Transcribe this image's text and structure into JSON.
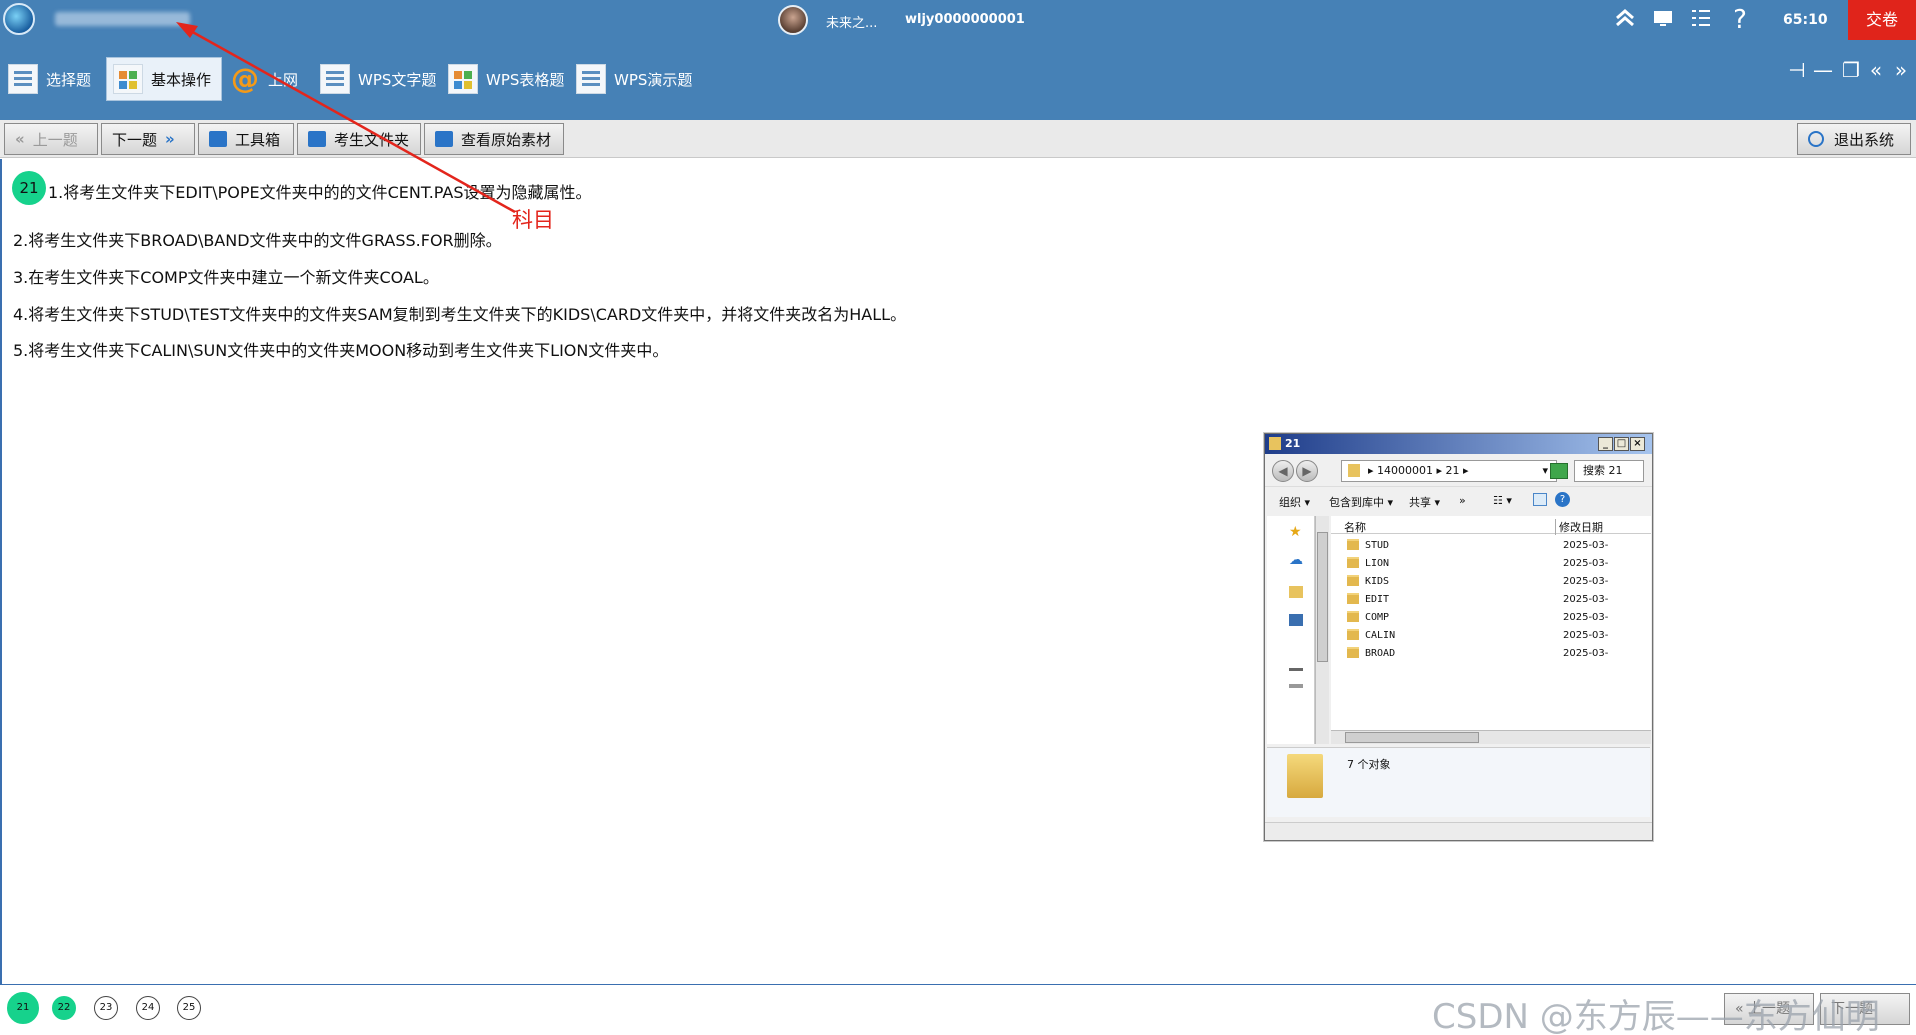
{
  "titlebar": {
    "user_name": "未来之...",
    "user_id": "wljy0000000001",
    "timer": "65:10",
    "submit_label": "交卷",
    "icons": [
      "collapse-icon",
      "monitor-icon",
      "checklist-icon",
      "help-icon"
    ],
    "help_glyph": "?"
  },
  "categories": [
    {
      "label": "选择题",
      "icon": "list-icon",
      "active": false
    },
    {
      "label": "基本操作",
      "icon": "grid-icon",
      "active": true
    },
    {
      "label": "上网",
      "icon": "at-icon",
      "active": false
    },
    {
      "label": "WPS文字题",
      "icon": "document-icon",
      "active": false
    },
    {
      "label": "WPS表格题",
      "icon": "spreadsheet-icon",
      "active": false
    },
    {
      "label": "WPS演示题",
      "icon": "presentation-icon",
      "active": false
    }
  ],
  "toolbar": {
    "prev_label": "上一题",
    "next_label": "下一题",
    "toolbox_label": "工具箱",
    "exam_folder_label": "考生文件夹",
    "view_material_label": "查看原始素材",
    "exit_label": "退出系统"
  },
  "question": {
    "number": "21",
    "lines": [
      "1.将考生文件夹下EDIT\\POPE文件夹中的的文件CENT.PAS设置为隐藏属性。",
      "2.将考生文件夹下BROAD\\BAND文件夹中的文件GRASS.FOR删除。",
      "3.在考生文件夹下COMP文件夹中建立一个新文件夹COAL。",
      "4.将考生文件夹下STUD\\TEST文件夹中的文件夹SAM复制到考生文件夹下的KIDS\\CARD文件夹中，并将文件夹改名为HALL。",
      "5.将考生文件夹下CALIN\\SUN文件夹中的文件夹MOON移动到考生文件夹下LION文件夹中。"
    ]
  },
  "annotation": {
    "label": "科目",
    "color": "#e3251c"
  },
  "explorer": {
    "title": "21",
    "address": "▸ 14000001 ▸ 21 ▸",
    "search_placeholder": "搜索 21",
    "commands": [
      "组织 ▾",
      "包含到库中 ▾",
      "共享 ▾",
      "»"
    ],
    "column_name": "名称",
    "column_date": "修改日期",
    "files": [
      {
        "name": "STUD",
        "date": "2025-03-"
      },
      {
        "name": "LION",
        "date": "2025-03-"
      },
      {
        "name": "KIDS",
        "date": "2025-03-"
      },
      {
        "name": "EDIT",
        "date": "2025-03-"
      },
      {
        "name": "COMP",
        "date": "2025-03-"
      },
      {
        "name": "CALIN",
        "date": "2025-03-"
      },
      {
        "name": "BROAD",
        "date": "2025-03-"
      }
    ],
    "status": "7 个对象"
  },
  "footer": {
    "questions": [
      {
        "number": "21",
        "done": true,
        "current": true
      },
      {
        "number": "22",
        "done": true,
        "current": false
      },
      {
        "number": "23",
        "done": false,
        "current": false
      },
      {
        "number": "24",
        "done": false,
        "current": false
      },
      {
        "number": "25",
        "done": false,
        "current": false
      }
    ],
    "watermark": "CSDN @东方辰——东方仙明",
    "prev_label": "« 上一题",
    "next_label": "下一题"
  },
  "colors": {
    "header_bg": "#4681b6",
    "submit_bg": "#e0241b",
    "done_badge": "#16d28c"
  }
}
